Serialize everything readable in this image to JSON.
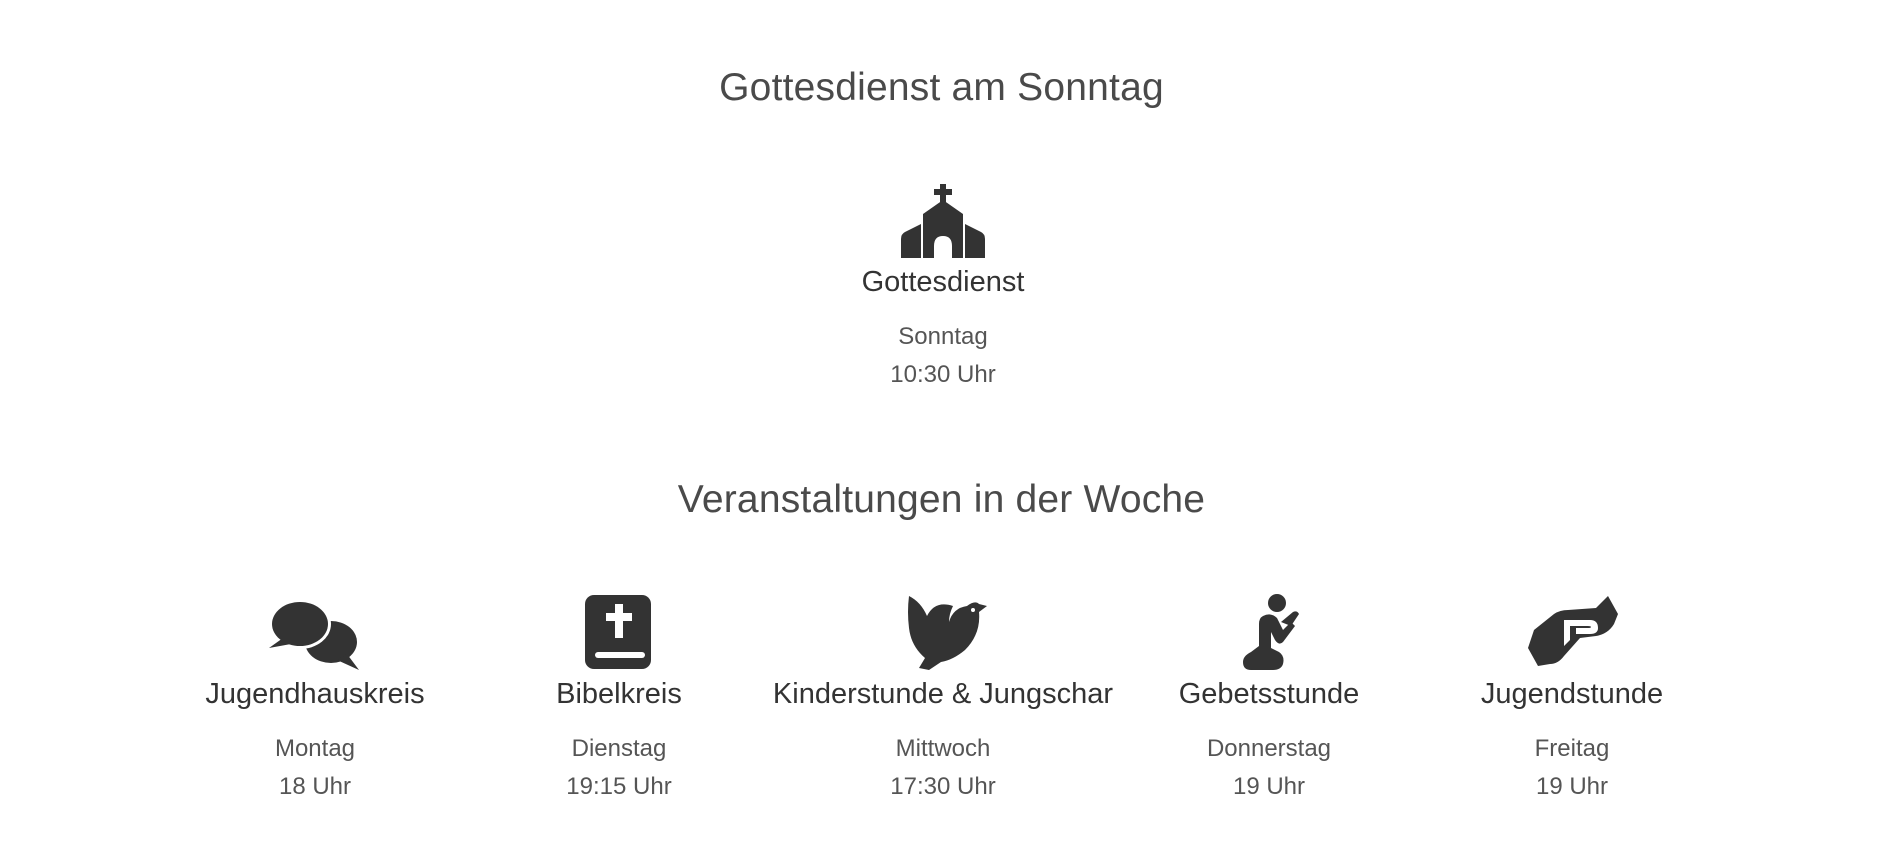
{
  "sunday_section": {
    "title": "Gottesdienst am Sonntag",
    "event": {
      "icon": "church-icon",
      "name": "Gottesdienst",
      "day": "Sonntag",
      "time": "10:30 Uhr"
    }
  },
  "week_section": {
    "title": "Veranstaltungen in der Woche",
    "events": [
      {
        "icon": "speech-bubbles-icon",
        "name": "Jugendhauskreis",
        "day": "Montag",
        "time": "18 Uhr"
      },
      {
        "icon": "bible-icon",
        "name": "Bibelkreis",
        "day": "Dienstag",
        "time": "19:15 Uhr"
      },
      {
        "icon": "dove-icon",
        "name": "Kinderstunde & Jungschar",
        "day": "Mittwoch",
        "time": "17:30 Uhr"
      },
      {
        "icon": "praying-person-icon",
        "name": "Gebetsstunde",
        "day": "Donnerstag",
        "time": "19 Uhr"
      },
      {
        "icon": "handshake-icon",
        "name": "Jugendstunde",
        "day": "Freitag",
        "time": "19 Uhr"
      }
    ]
  },
  "colors": {
    "icon": "#333333",
    "heading": "#4a4a4a",
    "text": "#555555"
  }
}
